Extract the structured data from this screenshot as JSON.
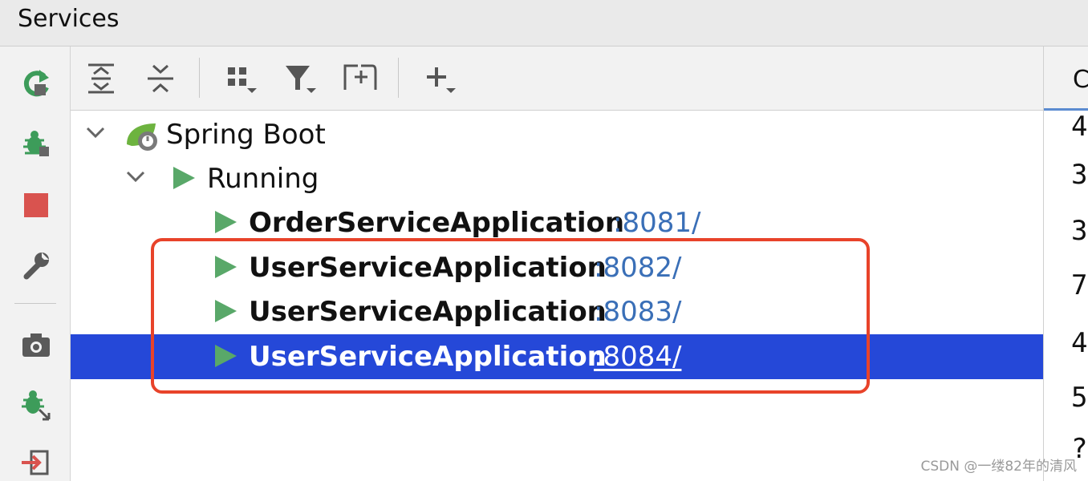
{
  "window": {
    "title": "Services"
  },
  "left_toolbar": {
    "icons": [
      "rerun-icon",
      "debug-icon",
      "stop-icon",
      "wrench-icon",
      "camera-icon",
      "debug-attach-icon",
      "login-icon"
    ]
  },
  "toolbar": {
    "icons": [
      "expand-all-icon",
      "collapse-all-icon",
      "group-by-icon",
      "filter-icon",
      "new-tab-icon",
      "add-service-icon"
    ]
  },
  "tree": {
    "root": {
      "label": "Spring Boot",
      "icon": "spring-boot-icon"
    },
    "group": {
      "label": "Running",
      "icon": "run-icon"
    },
    "apps": [
      {
        "name": "OrderServiceApplication",
        "port": ":8081/",
        "selected": false
      },
      {
        "name": "UserServiceApplication",
        "port": ":8082/",
        "selected": false
      },
      {
        "name": "UserServiceApplication",
        "port": ":8083/",
        "selected": false
      },
      {
        "name": "UserServiceApplication",
        "port": ":8084/",
        "selected": true
      }
    ]
  },
  "right_pane": {
    "tab_label": "C",
    "visible_digits": [
      "4",
      "3",
      "3",
      "7",
      "4",
      "5",
      "?"
    ]
  },
  "colors": {
    "selection": "#2548d8",
    "run_green": "#59a869",
    "port_blue": "#3a6fb7",
    "highlight_red": "#e8432a"
  },
  "watermark": "CSDN @一缕82年的清风"
}
